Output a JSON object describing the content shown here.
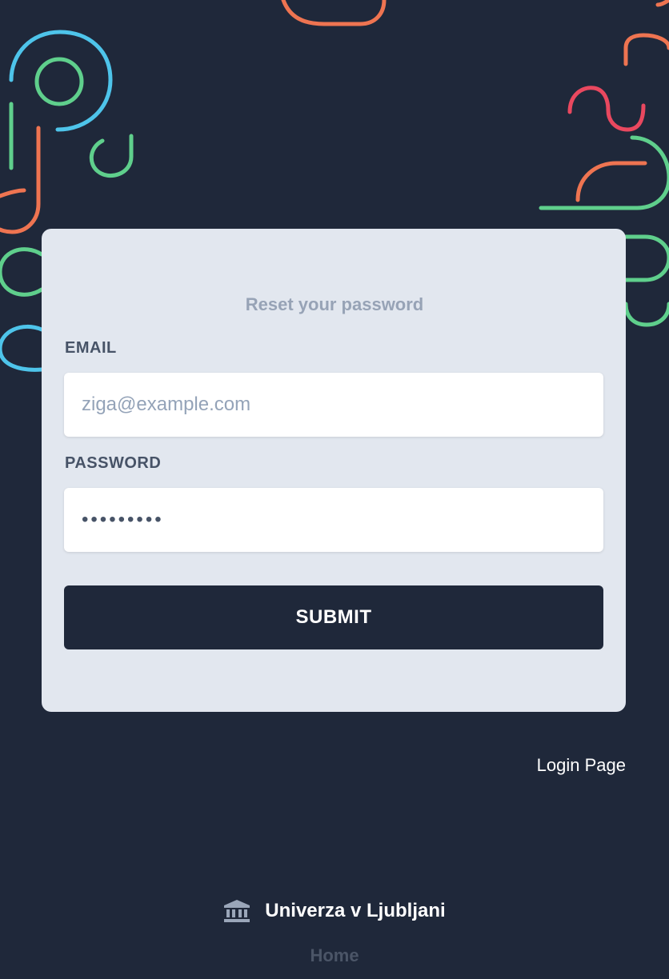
{
  "form": {
    "title": "Reset your password",
    "email_label": "EMAIL",
    "email_placeholder": "ziga@example.com",
    "password_label": "PASSWORD",
    "password_value": "123456789",
    "submit_label": "SUBMIT"
  },
  "links": {
    "login": "Login Page"
  },
  "footer": {
    "brand_icon": "institution-icon",
    "brand": "Univerza v Ljubljani",
    "home": "Home"
  },
  "colors": {
    "background": "#1f283a",
    "card": "#e2e7ef",
    "decor_blue": "#4ec4ea",
    "decor_green": "#5fcf8c",
    "decor_orange": "#ee7451",
    "decor_red": "#e9485f"
  }
}
